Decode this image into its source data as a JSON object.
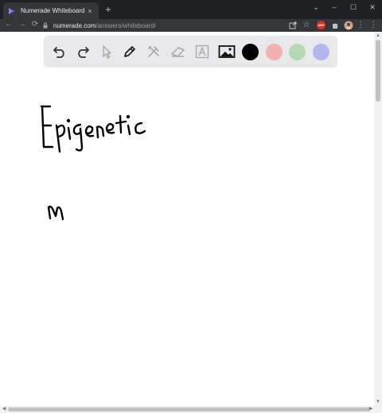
{
  "browser": {
    "tab_title": "Numerade Whiteboard",
    "tab_close": "×",
    "new_tab": "+",
    "window_controls": {
      "minimize": "–",
      "maximize": "☐",
      "close": "✕"
    },
    "url_host": "numerade.com",
    "url_path": "/answers/whiteboard/",
    "extension_badge": "ABP"
  },
  "whiteboard": {
    "tools": [
      "undo-icon",
      "redo-icon",
      "select-icon",
      "pen-icon",
      "tools-icon",
      "eraser-icon",
      "text-icon",
      "image-icon"
    ],
    "colors": {
      "black": "#000000",
      "red": "#f2b0b0",
      "green": "#b4d9b3",
      "blue": "#b4b4ee"
    },
    "handwriting": [
      "Epigenetic",
      "M"
    ]
  }
}
